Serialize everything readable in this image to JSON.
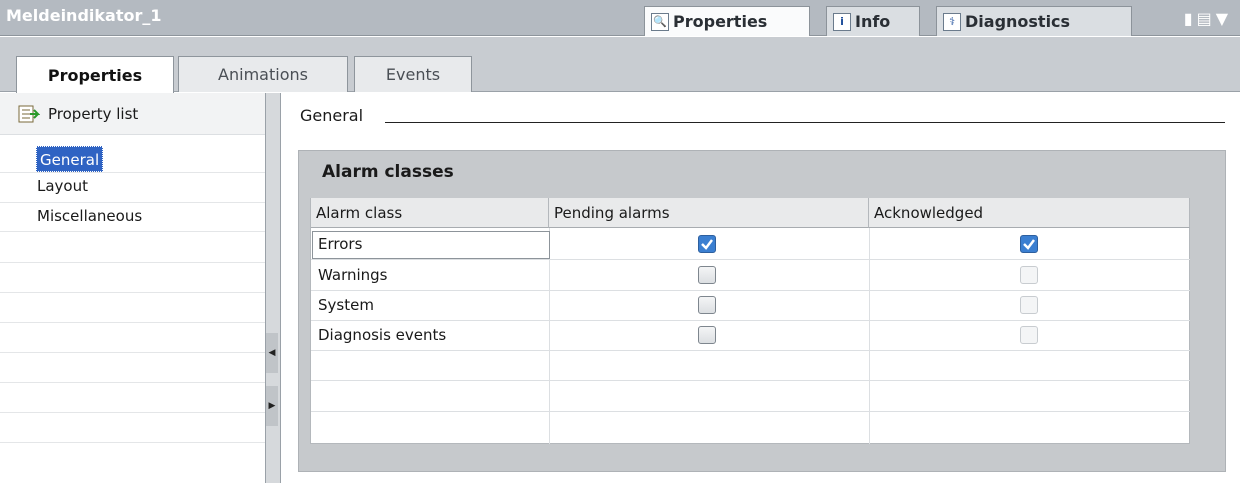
{
  "window": {
    "title": "Meldeindikator_1",
    "tabs": [
      {
        "label": "Properties",
        "icon": "properties-icon",
        "active": true
      },
      {
        "label": "Info",
        "icon": "info-icon",
        "active": false
      },
      {
        "label": "Diagnostics",
        "icon": "diagnostics-icon",
        "active": false
      }
    ],
    "controls": [
      "restore-icon",
      "menu-icon",
      "dropdown-icon"
    ]
  },
  "subtabs": [
    {
      "label": "Properties",
      "active": true
    },
    {
      "label": "Animations",
      "active": false
    },
    {
      "label": "Events",
      "active": false
    }
  ],
  "nav": {
    "header": "Property list",
    "items": [
      "General",
      "Layout",
      "Miscellaneous"
    ],
    "selected": "General"
  },
  "content": {
    "section_heading": "General",
    "group_title": "Alarm classes",
    "table": {
      "columns": [
        "Alarm class",
        "Pending alarms",
        "Acknowledged"
      ],
      "rows": [
        {
          "name": "Errors",
          "pending": true,
          "acknowledged": true,
          "acknowledged_enabled": true
        },
        {
          "name": "Warnings",
          "pending": false,
          "acknowledged": false,
          "acknowledged_enabled": false
        },
        {
          "name": "System",
          "pending": false,
          "acknowledged": false,
          "acknowledged_enabled": false
        },
        {
          "name": "Diagnosis events",
          "pending": false,
          "acknowledged": false,
          "acknowledged_enabled": false
        }
      ]
    }
  },
  "colors": {
    "selection": "#2f63c3",
    "checkbox_checked": "#3b7fd1",
    "titlebar": "#b4bac1"
  }
}
